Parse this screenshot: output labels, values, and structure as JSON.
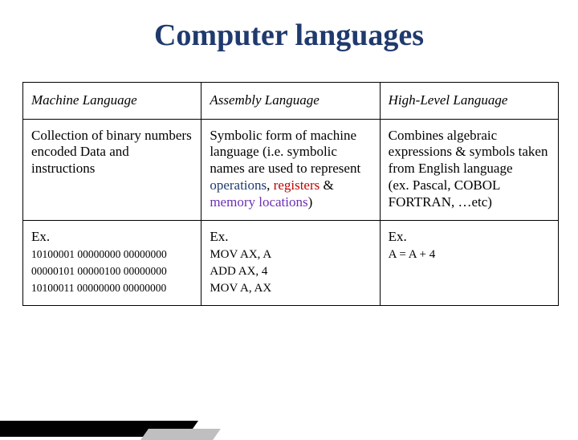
{
  "title": "Computer languages",
  "table": {
    "headers": [
      "Machine Language",
      "Assembly Language",
      "High-Level Language"
    ],
    "row_desc": {
      "machine": "Collection of binary numbers  encoded Data and instructions",
      "assembly": {
        "pre": "Symbolic form of machine language (i.e. symbolic names are used to represent ",
        "w1": "operations",
        "sep1": ", ",
        "w2": "registers",
        "sep2": " & ",
        "w3": "memory locations",
        "post": ")"
      },
      "highlevel": "Combines algebraic expressions & symbols taken from English language\n(ex. Pascal, COBOL FORTRAN, …etc)"
    },
    "row_ex": {
      "label": "Ex.",
      "machine_code": "10100001 00000000 00000000\n00000101 00000100 00000000\n10100011 00000000 00000000",
      "assembly_code": "MOV AX, A\nADD AX, 4\nMOV A, AX",
      "highlevel_code": "A = A + 4"
    }
  }
}
